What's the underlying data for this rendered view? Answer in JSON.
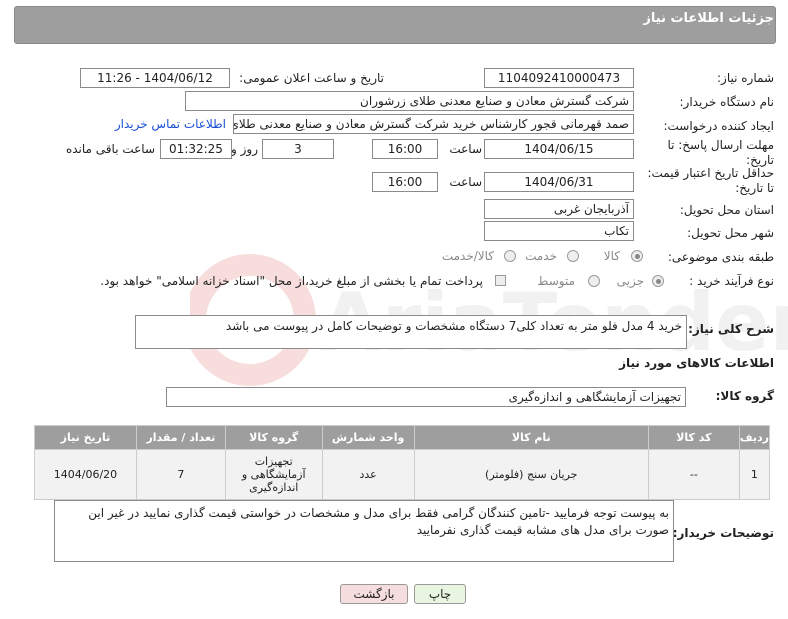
{
  "header": {
    "title": "جزئیات اطلاعات نیاز"
  },
  "form": {
    "need_number_label": "شماره نیاز:",
    "need_number": "1104092410000473",
    "announce_label": "تاریخ و ساعت اعلان عمومی:",
    "announce_value": "1404/06/12 - 11:26",
    "buyer_org_label": "نام دستگاه خریدار:",
    "buyer_org": "شرکت گسترش معادن و صنایع معدنی طلای زرشوران",
    "creator_label": "ایجاد کننده درخواست:",
    "creator": "صمد قهرمانی قجور کارشناس خرید شرکت گسترش معادن و صنایع معدنی طلای زرشوران",
    "contact_link": "اطلاعات تماس خریدار",
    "reply_deadline_label": "مهلت ارسال پاسخ: تا تاریخ:",
    "reply_date": "1404/06/15",
    "time_label": "ساعت",
    "reply_time": "16:00",
    "days_value": "3",
    "days_label": "روز و",
    "remaining_time": "01:32:25",
    "remaining_label": "ساعت باقی مانده",
    "price_validity_label": "حداقل تاریخ اعتبار قیمت: تا تاریخ:",
    "price_date": "1404/06/31",
    "price_time": "16:00",
    "province_label": "استان محل تحویل:",
    "province": "آذربایجان غربی",
    "city_label": "شهر محل تحویل:",
    "city": "تکاب",
    "category_label": "طبقه بندی موضوعی:",
    "category_options": [
      "کالا",
      "خدمت",
      "کالا/خدمت"
    ],
    "process_label": "نوع فرآیند خرید :",
    "process_options": [
      "جزیی",
      "متوسط"
    ],
    "payment_note": "پرداخت تمام یا بخشی از مبلغ خرید،از محل \"اسناد خزانه اسلامی\" خواهد بود.",
    "general_desc_label": "شرح کلی نیاز:",
    "general_desc": "خرید 4 مدل فلو متر به تعداد کلی7 دستگاه مشخصات و توضیحات کامل در پیوست می باشد"
  },
  "goods": {
    "section_title": "اطلاعات کالاهای مورد نیاز",
    "group_label": "گروه کالا:",
    "group_value": "تجهیزات آزمایشگاهی و اندازه‌گیری",
    "columns": [
      "ردیف",
      "کد کالا",
      "نام کالا",
      "واحد شمارش",
      "گروه کالا",
      "تعداد / مقدار",
      "تاریخ نیاز"
    ],
    "rows": [
      {
        "index": "1",
        "code": "--",
        "name": "جریان سنج (فلومتر)",
        "unit": "عدد",
        "group": "تجهیزات آزمایشگاهی و اندازه‌گیری",
        "qty": "7",
        "date": "1404/06/20"
      }
    ]
  },
  "buyer_notes": {
    "label": "توضیحات خریدار:",
    "text": "به پیوست توجه فرمایید -تامین کنندگان گرامی فقط برای مدل و مشخصات در خواستی قیمت گذاری نمایید در غیر این صورت برای مدل های مشابه قیمت گذاری نفرمایید"
  },
  "buttons": {
    "print": "چاپ",
    "back": "بازگشت"
  },
  "colors": {
    "header_bg": "#9e9e9e",
    "link": "#1a4fd6",
    "print_btn": "#e8f5e0",
    "back_btn": "#f6dede"
  }
}
